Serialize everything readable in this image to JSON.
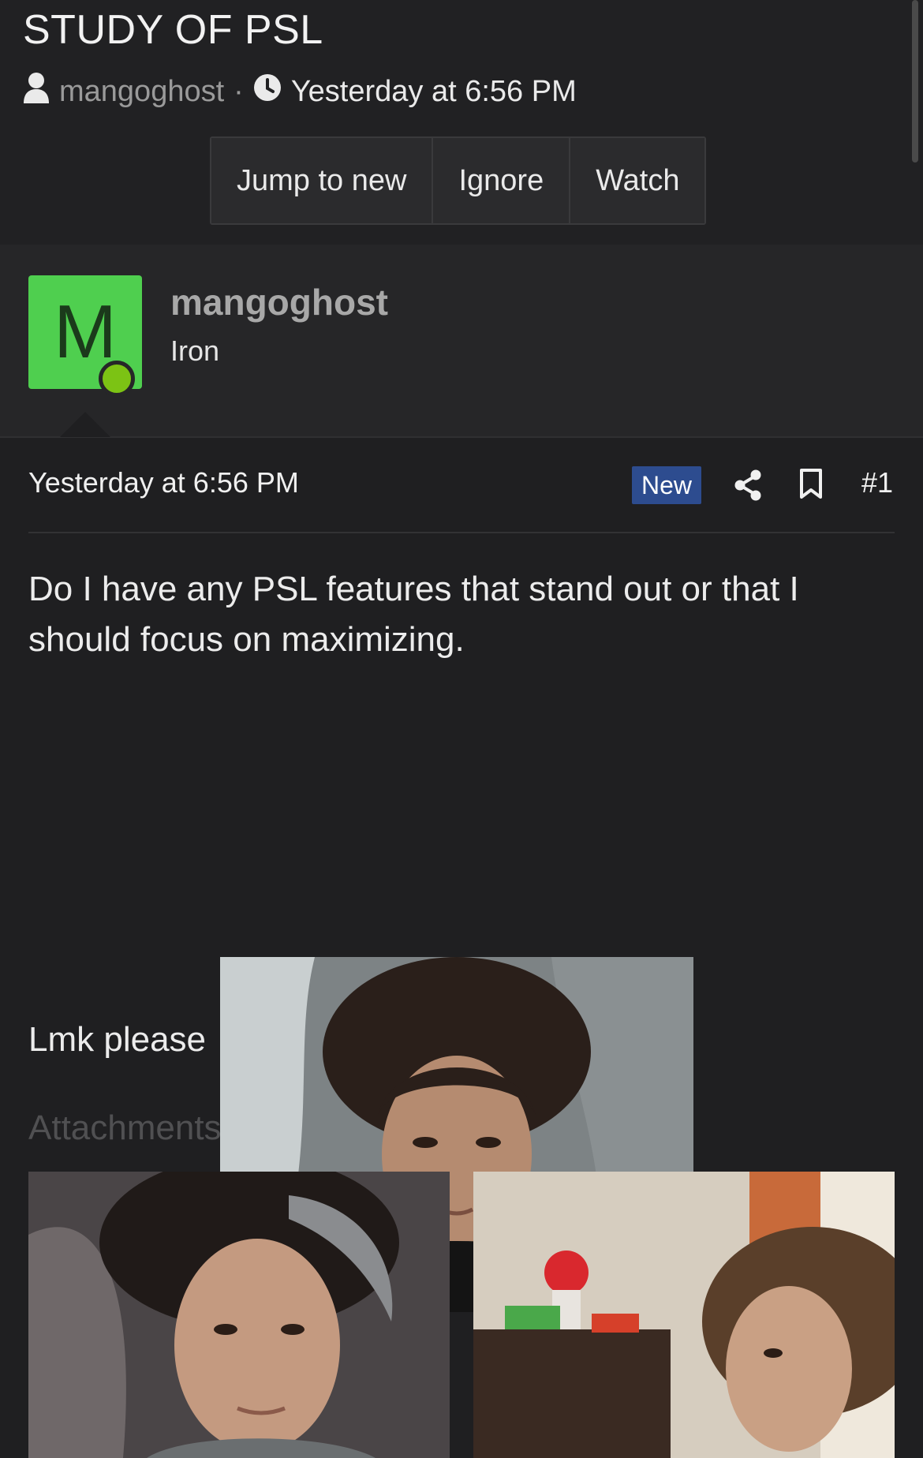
{
  "thread": {
    "title": "STUDY OF PSL",
    "author": "mangoghost",
    "separator": "·",
    "date": "Yesterday at 6:56 PM",
    "buttons": {
      "jump": "Jump to new",
      "ignore": "Ignore",
      "watch": "Watch"
    }
  },
  "post": {
    "user": {
      "initial": "M",
      "name": "mangoghost",
      "title": "Iron",
      "avatar_color": "#4fcf4f",
      "online_color": "#7cc314"
    },
    "date": "Yesterday at 6:56 PM",
    "badge": "New",
    "number": "#1",
    "message": "Do I have any PSL features that stand out or that I should focus on maximizing.",
    "inline_text": "Lmk please",
    "attachments_label": "Attachments"
  },
  "icons": {
    "author": "user-icon",
    "date": "clock-icon",
    "share": "share-icon",
    "bookmark": "bookmark-icon"
  },
  "colors": {
    "background": "#1f1f21",
    "badge_new": "#2d4c8f"
  }
}
